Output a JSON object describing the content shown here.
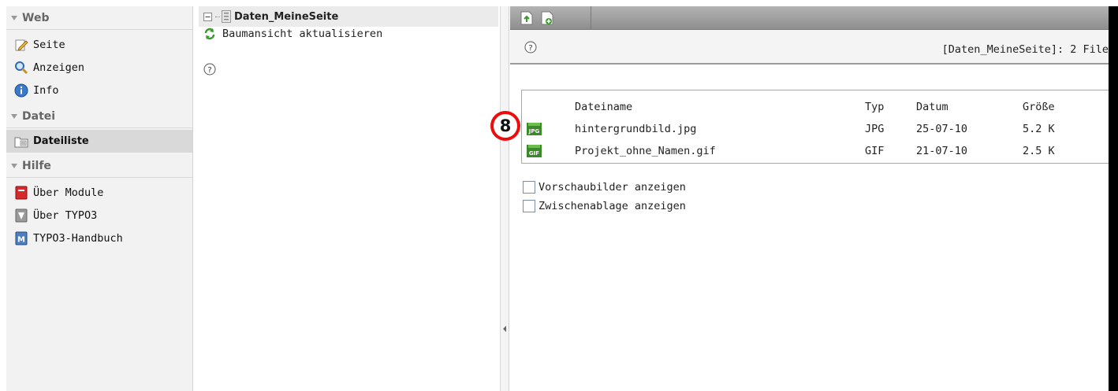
{
  "module_menu": {
    "sections": [
      {
        "title": "Web",
        "items": [
          {
            "label": "Seite",
            "icon": "page-edit-icon"
          },
          {
            "label": "Anzeigen",
            "icon": "magnifier-icon"
          },
          {
            "label": "Info",
            "icon": "info-icon"
          }
        ]
      },
      {
        "title": "Datei",
        "items": [
          {
            "label": "Dateiliste",
            "icon": "folder-list-icon",
            "active": true
          }
        ]
      },
      {
        "title": "Hilfe",
        "items": [
          {
            "label": "Über Module",
            "icon": "book-red-icon"
          },
          {
            "label": "Über TYPO3",
            "icon": "typo3-shield-icon"
          },
          {
            "label": "TYPO3-Handbuch",
            "icon": "manual-icon"
          }
        ]
      }
    ]
  },
  "tree": {
    "root_label": "Daten_MeineSeite",
    "refresh_label": "Baumansicht aktualisieren"
  },
  "content": {
    "path_info": "[Daten_MeineSeite]: 2 File",
    "columns": {
      "name": "Dateiname",
      "type": "Typ",
      "date": "Datum",
      "size": "Größe"
    },
    "files": [
      {
        "icon_label": "JPG",
        "name": "hintergrundbild.jpg",
        "type": "JPG",
        "date": "25-07-10",
        "size": "5.2 K"
      },
      {
        "icon_label": "GIF",
        "name": "Projekt_ohne_Namen.gif",
        "type": "GIF",
        "date": "21-07-10",
        "size": "2.5 K"
      }
    ],
    "options": {
      "thumbnails_label": "Vorschaubilder anzeigen",
      "clipboard_label": "Zwischenablage anzeigen"
    }
  },
  "annotation": {
    "marker_number": "8",
    "marker_color": "#ee0b0b"
  },
  "colors": {
    "menu_bg": "#f2f2f2",
    "active_item_bg": "#d9d9d9",
    "toolbar_bg": "#9e9e9e",
    "file_icon_green": "#3a8a2a"
  }
}
